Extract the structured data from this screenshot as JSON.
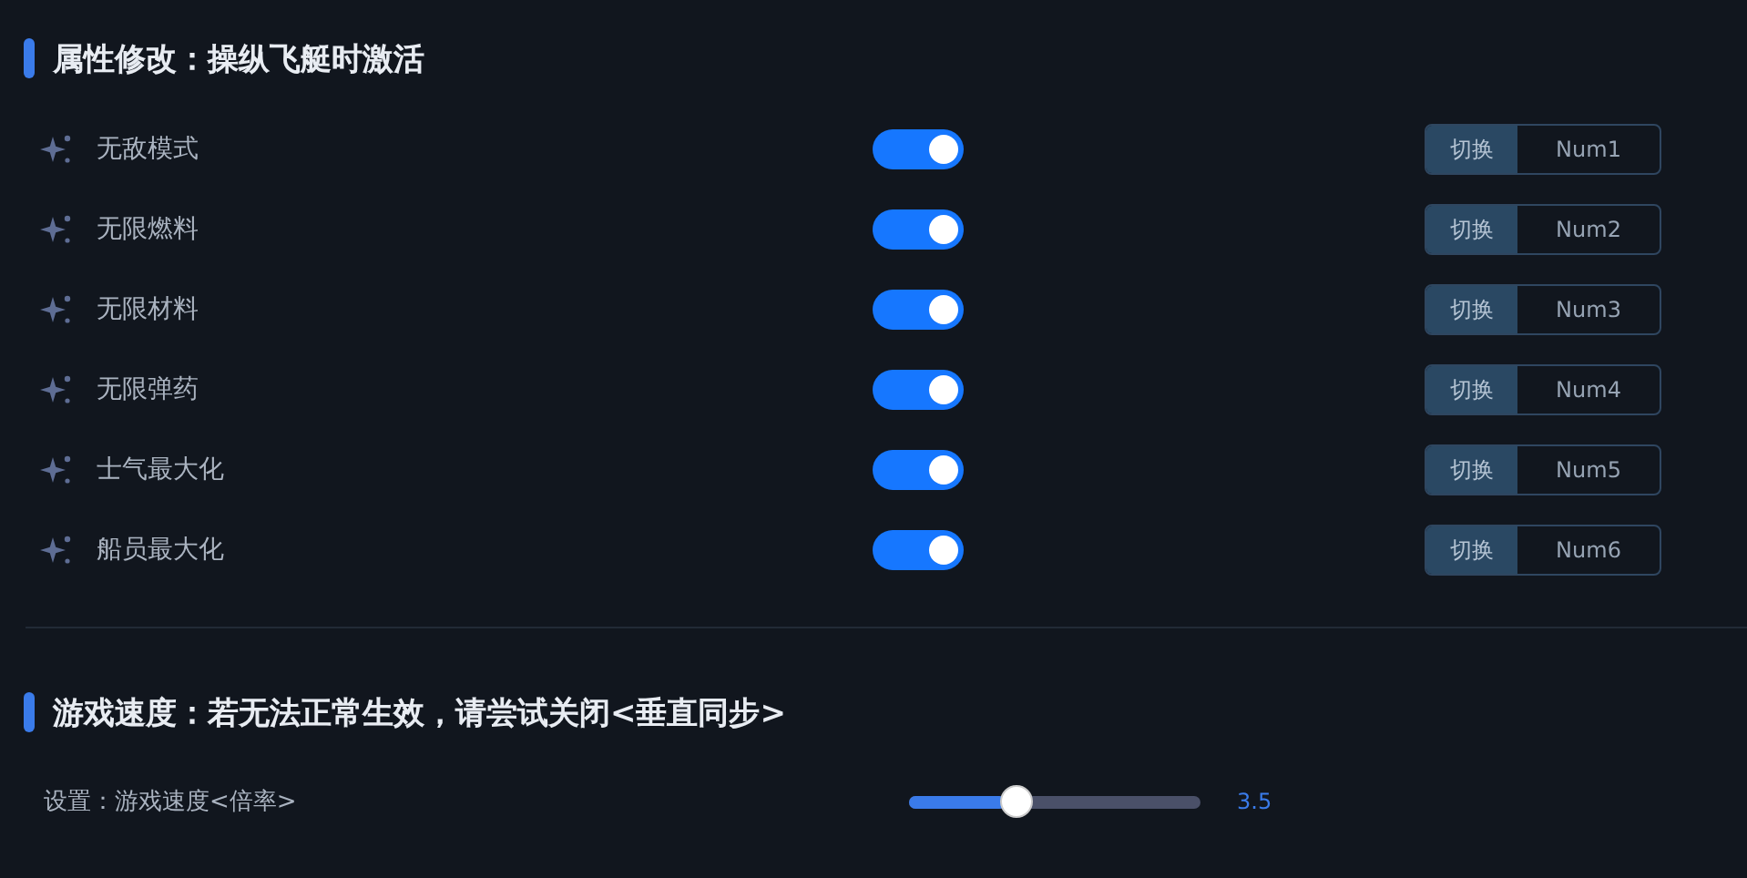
{
  "sections": [
    {
      "title": "属性修改：操纵飞艇时激活",
      "kind": "toggles",
      "items": [
        {
          "label": "无敌模式",
          "on": true,
          "action": "切换",
          "hotkey": "Num1"
        },
        {
          "label": "无限燃料",
          "on": true,
          "action": "切换",
          "hotkey": "Num2"
        },
        {
          "label": "无限材料",
          "on": true,
          "action": "切换",
          "hotkey": "Num3"
        },
        {
          "label": "无限弹药",
          "on": true,
          "action": "切换",
          "hotkey": "Num4"
        },
        {
          "label": "士气最大化",
          "on": true,
          "action": "切换",
          "hotkey": "Num5"
        },
        {
          "label": "船员最大化",
          "on": true,
          "action": "切换",
          "hotkey": "Num6"
        }
      ]
    },
    {
      "title": "游戏速度：若无法正常生效，请尝试关闭<垂直同步>",
      "kind": "sliders",
      "items": [
        {
          "label": "设置：游戏速度<倍率>",
          "level": 0.33,
          "reading": "3.5"
        }
      ]
    }
  ]
}
